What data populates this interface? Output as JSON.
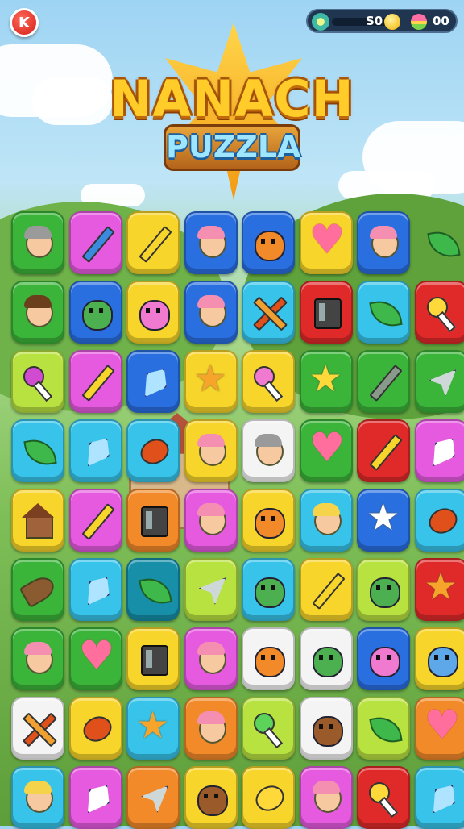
{
  "hud": {
    "close_badge": "K",
    "coins": "S0",
    "gems": "00"
  },
  "logo": {
    "title": "NANACH",
    "subtitle": "PUZZLA"
  },
  "board": {
    "rows": 9,
    "cols": 8,
    "tiles": [
      [
        {
          "color": "green",
          "icon": "face",
          "variant": "glasses-girl-icon"
        },
        {
          "color": "magenta",
          "icon": "pencil",
          "variant": "blue-pencil-icon"
        },
        {
          "color": "yellow",
          "icon": "pencil",
          "variant": "pencil-icon"
        },
        {
          "color": "blue",
          "icon": "face",
          "variant": "pink-hair-girl-icon"
        },
        {
          "color": "blue",
          "icon": "creature",
          "variant": "orange-cat-icon"
        },
        {
          "color": "yellow",
          "icon": "heart",
          "variant": "heart-icon"
        },
        {
          "color": "blue",
          "icon": "face",
          "variant": "pink-hair-girl-icon"
        },
        {
          "color": "none",
          "icon": "leaf",
          "variant": "leaf-icon"
        }
      ],
      [
        {
          "color": "green",
          "icon": "face",
          "variant": "brown-hair-woman-icon"
        },
        {
          "color": "blue",
          "icon": "creature",
          "variant": "green-cactus-icon"
        },
        {
          "color": "yellow",
          "icon": "creature",
          "variant": "pink-cat-icon"
        },
        {
          "color": "blue",
          "icon": "face",
          "variant": "pink-hair-girl-icon"
        },
        {
          "color": "skyblue",
          "icon": "cross",
          "variant": "crossed-pencils-icon"
        },
        {
          "color": "red",
          "icon": "device",
          "variant": "device-icon"
        },
        {
          "color": "skyblue",
          "icon": "leaf",
          "variant": "leaf-icon"
        },
        {
          "color": "red",
          "icon": "lolly",
          "variant": "yellow-lollipop-icon"
        }
      ],
      [
        {
          "color": "lime",
          "icon": "lolly",
          "variant": "purple-lollipop-icon"
        },
        {
          "color": "magenta",
          "icon": "pencil",
          "variant": "yellow-pencil-icon"
        },
        {
          "color": "blue",
          "icon": "crystal",
          "variant": "crystal-icon"
        },
        {
          "color": "yellow",
          "icon": "star",
          "variant": "star-creature-icon"
        },
        {
          "color": "yellow",
          "icon": "lolly",
          "variant": "pink-lollipop-icon"
        },
        {
          "color": "green",
          "icon": "star",
          "variant": "star-icon"
        },
        {
          "color": "green",
          "icon": "pencil",
          "variant": "grey-pencil-icon"
        },
        {
          "color": "green",
          "icon": "arrow",
          "variant": "arrowhead-icon"
        }
      ],
      [
        {
          "color": "skyblue",
          "icon": "leaf",
          "variant": "leaf-icon"
        },
        {
          "color": "skyblue",
          "icon": "crystal",
          "variant": "crystal-icon"
        },
        {
          "color": "skyblue",
          "icon": "ball",
          "variant": "football-icon"
        },
        {
          "color": "yellow",
          "icon": "face",
          "variant": "pink-hair-girl-icon"
        },
        {
          "color": "white",
          "icon": "face",
          "variant": "grey-hair-boy-icon"
        },
        {
          "color": "green",
          "icon": "heart",
          "variant": "heart-icon"
        },
        {
          "color": "red",
          "icon": "pencil",
          "variant": "yellow-pencil-icon"
        },
        {
          "color": "magenta",
          "icon": "crystal",
          "variant": "white-crystal-icon"
        }
      ],
      [
        {
          "color": "yellow",
          "icon": "house",
          "variant": "house-icon"
        },
        {
          "color": "magenta",
          "icon": "pencil",
          "variant": "yellow-pencil-icon"
        },
        {
          "color": "orange",
          "icon": "device",
          "variant": "device-icon"
        },
        {
          "color": "magenta",
          "icon": "face",
          "variant": "pink-hair-girl-icon"
        },
        {
          "color": "yellow",
          "icon": "creature",
          "variant": "orange-star-creature-icon"
        },
        {
          "color": "skyblue",
          "icon": "face",
          "variant": "blonde-girl-icon"
        },
        {
          "color": "blue",
          "icon": "star",
          "variant": "white-star-icon"
        },
        {
          "color": "skyblue",
          "icon": "ball",
          "variant": "football-icon"
        }
      ],
      [
        {
          "color": "green",
          "icon": "horn",
          "variant": "horn-icon"
        },
        {
          "color": "skyblue",
          "icon": "crystal",
          "variant": "crystal-icon"
        },
        {
          "color": "teal",
          "icon": "leaf",
          "variant": "leaf-icon"
        },
        {
          "color": "lime",
          "icon": "arrow",
          "variant": "arrowhead-icon"
        },
        {
          "color": "skyblue",
          "icon": "creature",
          "variant": "green-cactus-icon"
        },
        {
          "color": "yellow",
          "icon": "pencil",
          "variant": "pencil-icon"
        },
        {
          "color": "lime",
          "icon": "creature",
          "variant": "green-dino-icon"
        },
        {
          "color": "red",
          "icon": "star",
          "variant": "star-creature-icon"
        }
      ],
      [
        {
          "color": "green",
          "icon": "face",
          "variant": "pink-hair-boy-icon"
        },
        {
          "color": "green",
          "icon": "heart",
          "variant": "heart-icon"
        },
        {
          "color": "yellow",
          "icon": "device",
          "variant": "green-device-icon"
        },
        {
          "color": "magenta",
          "icon": "face",
          "variant": "pink-hair-girl-icon"
        },
        {
          "color": "white",
          "icon": "creature",
          "variant": "orange-cat-icon"
        },
        {
          "color": "white",
          "icon": "creature",
          "variant": "green-cactus-icon"
        },
        {
          "color": "blue",
          "icon": "creature",
          "variant": "pink-monster-icon"
        },
        {
          "color": "yellow",
          "icon": "creature",
          "variant": "blue-monster-icon"
        }
      ],
      [
        {
          "color": "white",
          "icon": "cross",
          "variant": "crossed-pencils-icon"
        },
        {
          "color": "yellow",
          "icon": "ball",
          "variant": "football-icon"
        },
        {
          "color": "skyblue",
          "icon": "star",
          "variant": "star-creature-icon"
        },
        {
          "color": "orange",
          "icon": "face",
          "variant": "pink-hair-girl-icon"
        },
        {
          "color": "lime",
          "icon": "lolly",
          "variant": "green-lollipop-icon"
        },
        {
          "color": "white",
          "icon": "creature",
          "variant": "brown-monster-icon"
        },
        {
          "color": "lime",
          "icon": "leaf",
          "variant": "leaf-icon"
        },
        {
          "color": "orange",
          "icon": "heart",
          "variant": "heart-icon"
        }
      ],
      [
        {
          "color": "skyblue",
          "icon": "face",
          "variant": "blonde-girl-icon"
        },
        {
          "color": "magenta",
          "icon": "crystal",
          "variant": "white-crystal-icon"
        },
        {
          "color": "orange",
          "icon": "arrow",
          "variant": "arrowhead-icon"
        },
        {
          "color": "yellow",
          "icon": "creature",
          "variant": "brown-potato-icon"
        },
        {
          "color": "yellow",
          "icon": "ball",
          "variant": "yellow-ball-icon"
        },
        {
          "color": "magenta",
          "icon": "face",
          "variant": "pink-hair-girl-icon"
        },
        {
          "color": "red",
          "icon": "lolly",
          "variant": "yellow-lollipop-icon"
        },
        {
          "color": "skyblue",
          "icon": "crystal",
          "variant": "crystal-icon"
        }
      ]
    ]
  },
  "colors": {
    "hud_bg": "#1f3550",
    "close_button": "#d41d16",
    "logo_gold": "#ffcc2a",
    "logo_blue": "#9ee6ff"
  }
}
